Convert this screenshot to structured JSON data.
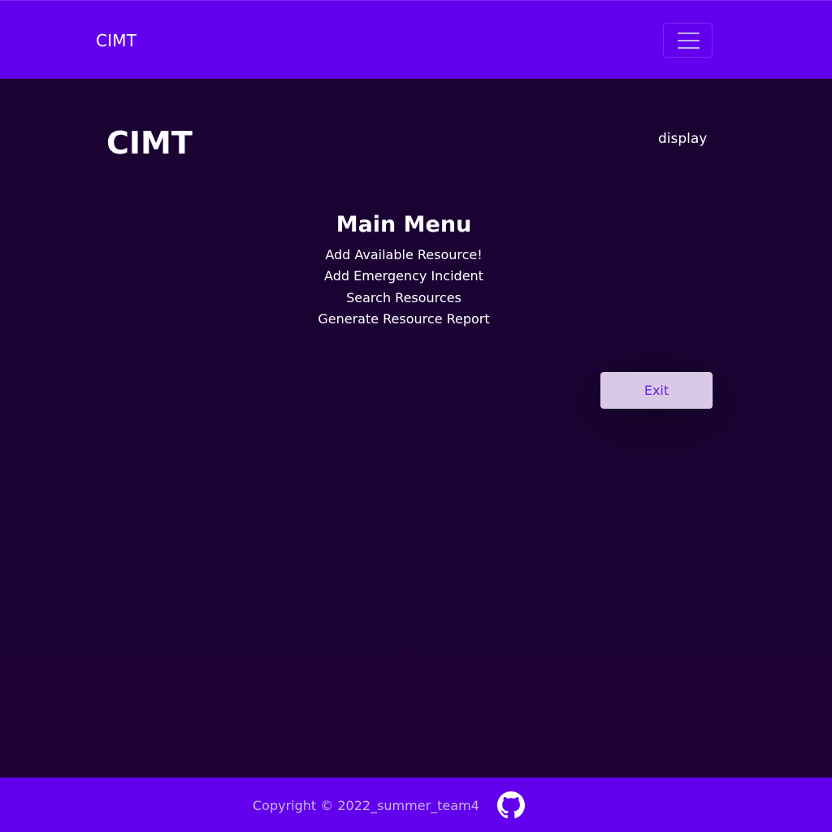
{
  "navbar": {
    "brand": "CIMT",
    "menu_toggle_icon": "hamburger-menu-icon"
  },
  "header": {
    "title": "CIMT",
    "display_link": "display"
  },
  "menu": {
    "heading": "Main Menu",
    "items": [
      {
        "label": "Add Available Resource!"
      },
      {
        "label": "Add Emergency Incident"
      },
      {
        "label": "Search Resources"
      },
      {
        "label": "Generate Resource Report"
      }
    ]
  },
  "exit_button": {
    "label": "Exit"
  },
  "footer": {
    "copyright": "Copyright © 2022_summer_team4",
    "github_icon": "github-icon"
  },
  "colors": {
    "navbar_bg": "#6200ee",
    "page_bg": "#1c0231",
    "exit_button_bg": "#d9c9e6",
    "exit_button_text": "#6a1fe6"
  }
}
